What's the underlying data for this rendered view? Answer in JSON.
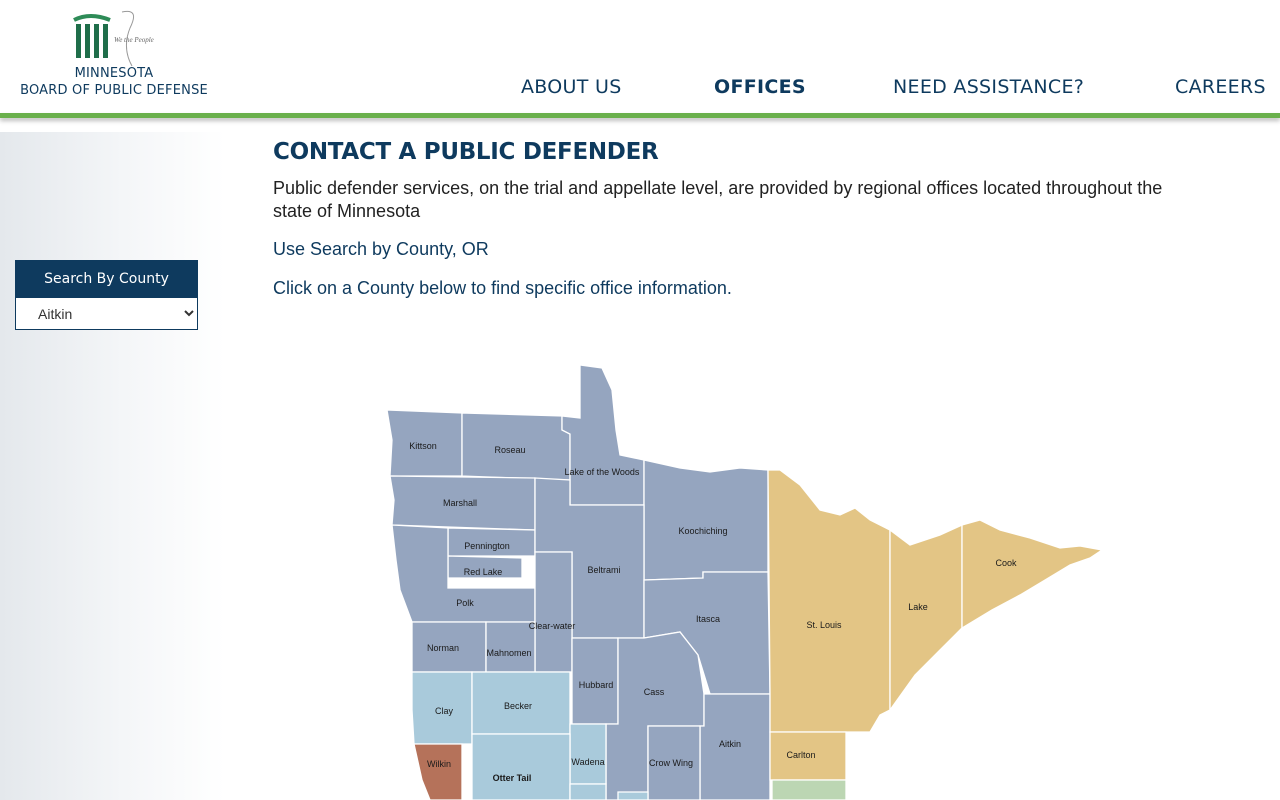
{
  "header": {
    "logo_line1": "MINNESOTA",
    "logo_line2": "BOARD OF PUBLIC DEFENSE",
    "logo_script": "We the People",
    "nav": [
      {
        "label": "ABOUT US",
        "active": false
      },
      {
        "label": "OFFICES",
        "active": true
      },
      {
        "label": "NEED ASSISTANCE?",
        "active": false
      },
      {
        "label": "CAREERS",
        "active": false
      }
    ]
  },
  "sidebar": {
    "search_title": "Search By County",
    "selected_county": "Aitkin"
  },
  "main": {
    "title": "CONTACT A PUBLIC DEFENDER",
    "intro": "Public defender services, on the trial and appellate level, are provided by regional offices located throughout the state of Minnesota",
    "instruction1": "Use Search by County, OR",
    "instruction2": "Click on a County below to find specific office information."
  },
  "map": {
    "counties": {
      "kittson": "Kittson",
      "roseau": "Roseau",
      "lake_of_the_woods": "Lake of the Woods",
      "marshall": "Marshall",
      "koochiching": "Koochiching",
      "pennington": "Pennington",
      "red_lake": "Red Lake",
      "polk": "Polk",
      "beltrami": "Beltrami",
      "clearwater": "Clear-water",
      "norman": "Norman",
      "mahnomen": "Mahnomen",
      "itasca": "Itasca",
      "st_louis": "St. Louis",
      "lake": "Lake",
      "cook": "Cook",
      "hubbard": "Hubbard",
      "cass": "Cass",
      "clay": "Clay",
      "becker": "Becker",
      "aitkin": "Aitkin",
      "carlton": "Carlton",
      "wadena": "Wadena",
      "crow_wing": "Crow Wing",
      "wilkin": "Wilkin",
      "otter_tail": "Otter Tail"
    },
    "colors": {
      "northwest": "#95a5bf",
      "northeast": "#e3c585",
      "west_central": "#a9cadb",
      "wilkin": "#b5725a",
      "pine": "#bcd6b3",
      "border": "#ffffff"
    }
  }
}
